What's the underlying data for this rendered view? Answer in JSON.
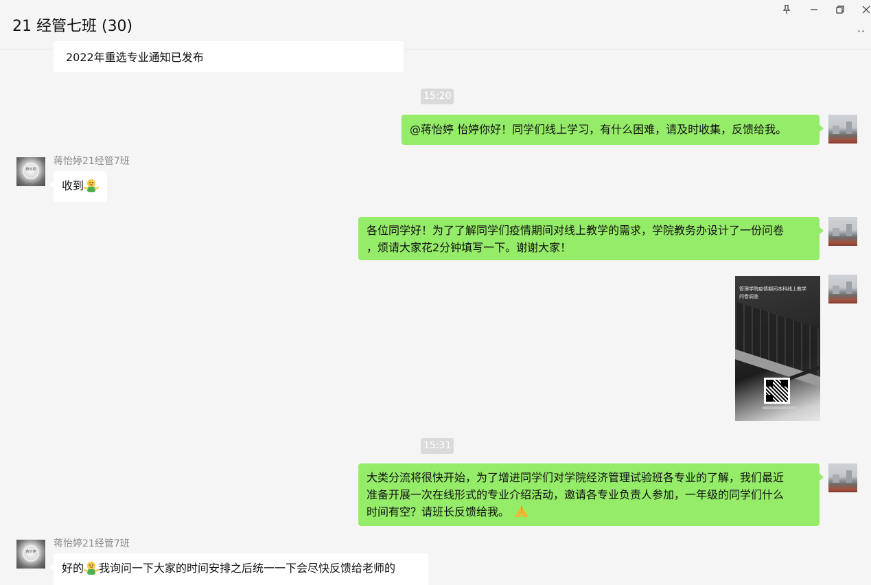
{
  "window": {
    "title": "21 经管七班 (30)",
    "pin_glyph": "⊥",
    "minimize_glyph": "—",
    "restore_glyph": "❐",
    "close_glyph": "✕",
    "more_glyph": "··"
  },
  "messages": {
    "m0": {
      "text": "2022年重选专业通知已发布"
    },
    "t1": {
      "text": "15:20"
    },
    "m1": {
      "text": "@蒋怡婷 怡婷你好！同学们线上学习，有什么困难，请及时收集，反馈给我。"
    },
    "m2": {
      "sender": "蒋怡婷21经管7班",
      "text": "收到"
    },
    "m3": {
      "line1": "各位同学好！为了了解同学们疫情期间对线上教学的需求，学院教务办设计了一份问卷",
      "line2": "，烦请大家花2分钟填写一下。谢谢大家！"
    },
    "m4": {
      "caption_line1": "管理学院疫情期间本科线上教学",
      "caption_line2": "问卷调查"
    },
    "t2": {
      "text": "15:31"
    },
    "m5": {
      "line1": "大类分流将很快开始，为了增进同学们对学院经济管理试验班各专业的了解，我们最近",
      "line2": "准备开展一次在线形式的专业介绍活动，邀请各专业负责人参加，一年级的同学们什么",
      "line3": "时间有空？请班长反馈给我。"
    },
    "m6": {
      "sender": "蒋怡婷21经管7班",
      "text_before": "好的",
      "text_after": "我询问一下大家的时间安排之后统一一下会尽快反馈给老师的"
    }
  },
  "avatars": {
    "other_text": "蒋怡婷"
  },
  "colors": {
    "out_bubble": "#95ec69",
    "in_bubble": "#ffffff",
    "background": "#f5f5f5"
  }
}
